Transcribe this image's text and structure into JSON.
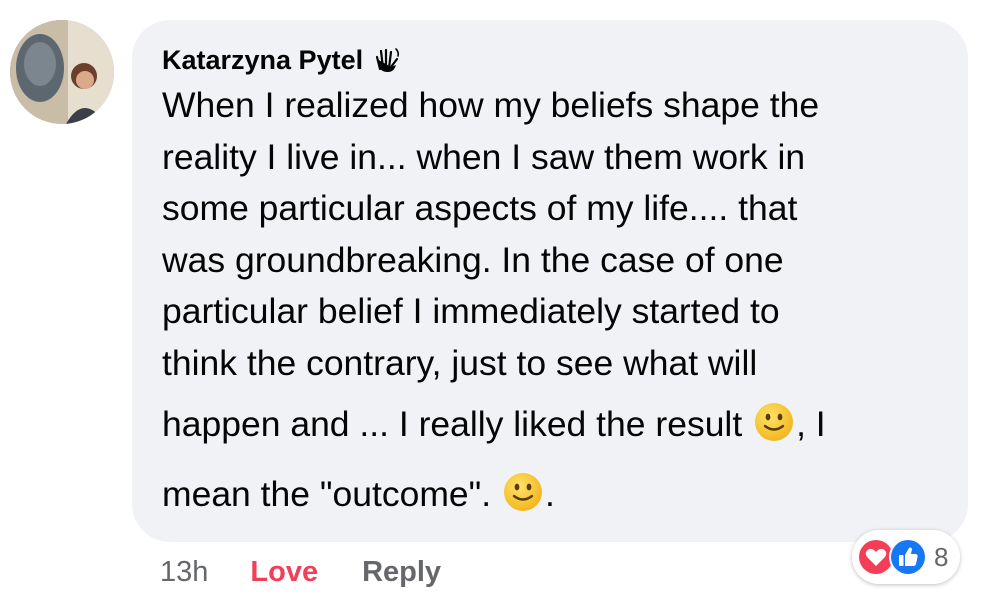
{
  "comment": {
    "author": "Katarzyna Pytel",
    "author_badge": "waving-hand-icon",
    "lines": [
      "When I realized how my beliefs shape the",
      "reality I live in... when I saw them work in",
      "some particular aspects of my life.... that",
      "was groundbreaking. In the case of one",
      "particular belief I immediately started to",
      "think the contrary, just to see what will"
    ],
    "line7_before": "happen and ... I really liked the result ",
    "line7_after": ", I",
    "line8_before": "mean the \"outcome\". ",
    "line8_after": ".",
    "emoji": "slightly-smiling-face"
  },
  "actions": {
    "timestamp": "13h",
    "love_label": "Love",
    "reply_label": "Reply"
  },
  "reactions": {
    "icons": [
      "love-icon",
      "like-icon"
    ],
    "count": "8"
  },
  "colors": {
    "bubble": "#f0f2f5",
    "love": "#f33e58",
    "like": "#1877f2",
    "muted": "#65676b"
  }
}
